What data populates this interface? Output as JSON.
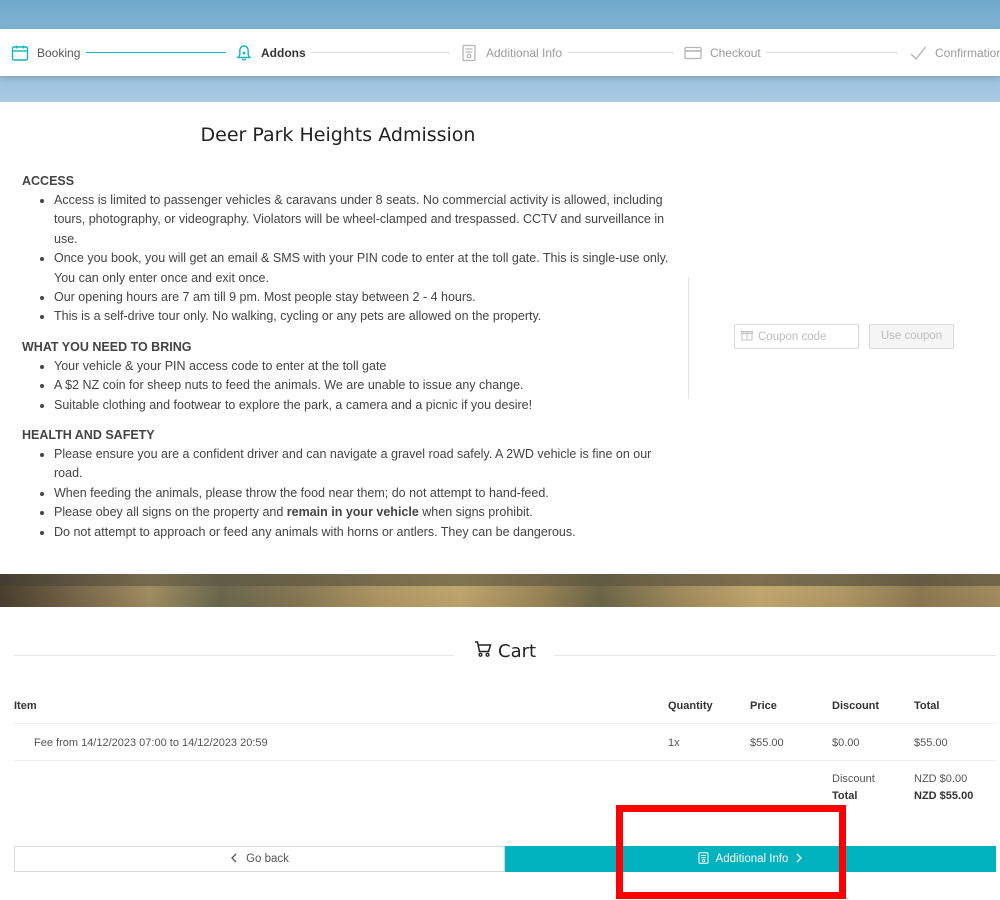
{
  "stepper": {
    "steps": [
      {
        "label": "Booking",
        "state": "done",
        "icon": "calendar-icon"
      },
      {
        "label": "Addons",
        "state": "active",
        "icon": "bell-icon"
      },
      {
        "label": "Additional Info",
        "state": "pending",
        "icon": "document-icon"
      },
      {
        "label": "Checkout",
        "state": "pending",
        "icon": "credit-card-icon"
      },
      {
        "label": "Confirmation",
        "state": "pending",
        "icon": "check-icon"
      }
    ],
    "accent": "#11b7bd"
  },
  "product": {
    "title": "Deer Park Heights Admission",
    "sections": [
      {
        "heading": "ACCESS",
        "items": [
          "Access is limited to passenger vehicles & caravans under 8 seats. No commercial activity is allowed, including tours, photography, or videography. Violators will be wheel-clamped and trespassed. CCTV and surveillance in use.",
          "Once you book, you will get an email & SMS with your PIN code to enter at the toll gate. This is single-use only. You can only enter once and exit once.",
          "Our opening hours are 7 am till 9 pm. Most people stay between 2 - 4 hours.",
          "This is a self-drive tour only. No walking, cycling or any pets are allowed on the property."
        ]
      },
      {
        "heading": "WHAT YOU NEED TO BRING",
        "items": [
          "Your vehicle & your PIN access code to enter at the toll gate",
          "A $2 NZ coin for sheep nuts to feed the animals. We are unable to issue any change.",
          "Suitable clothing and footwear to explore the park, a camera and a picnic if you desire!"
        ]
      },
      {
        "heading": "HEALTH AND SAFETY",
        "items": [
          "Please ensure you are a confident driver and can navigate a gravel road safely. A 2WD vehicle is fine on our road.",
          "When feeding the animals, please throw the food near them; do not attempt to hand-feed.",
          "Please obey all signs on the property and ",
          "Do not attempt to approach or feed any animals with horns or antlers. They can be dangerous."
        ],
        "bold_fragment": "remain in your vehicle",
        "tail_fragment": " when signs prohibit."
      }
    ]
  },
  "coupon": {
    "placeholder": "Coupon code",
    "button_label": "Use coupon"
  },
  "cart": {
    "title": "Cart",
    "columns": [
      "Item",
      "Quantity",
      "Price",
      "Discount",
      "Total"
    ],
    "rows": [
      {
        "item": "Fee from 14/12/2023 07:00 to 14/12/2023 20:59",
        "quantity": "1x",
        "price": "$55.00",
        "discount": "$0.00",
        "total": "$55.00"
      }
    ],
    "summary": {
      "discount_label": "Discount",
      "discount_value": "NZD $0.00",
      "total_label": "Total",
      "total_value": "NZD $55.00"
    }
  },
  "actions": {
    "back_label": "Go back",
    "next_label": "Additional Info",
    "next_color": "#00b2bd"
  },
  "highlight_color": "#ff0000"
}
